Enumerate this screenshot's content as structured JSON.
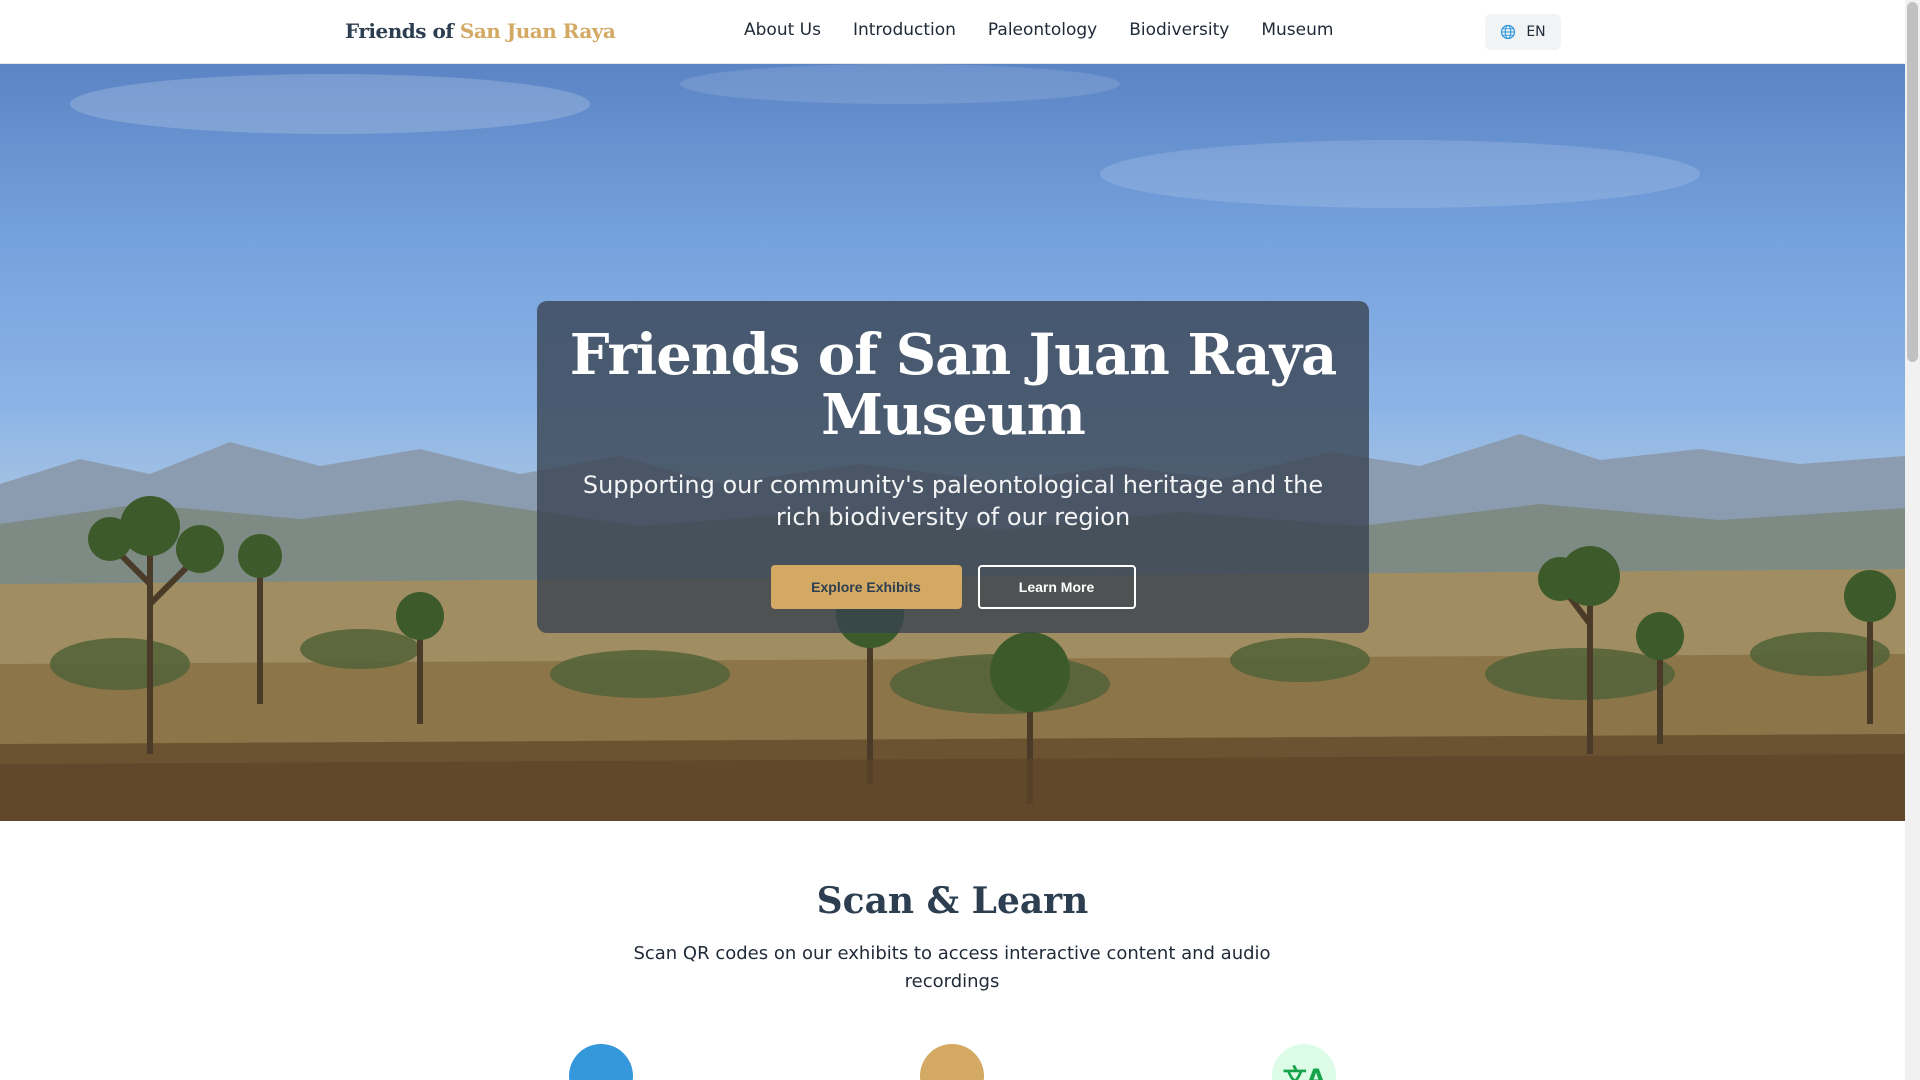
{
  "nav": {
    "logo_part1": "Friends of",
    "logo_part2": "San Juan Raya",
    "links": [
      "About Us",
      "Introduction",
      "Paleontology",
      "Biodiversity",
      "Museum"
    ],
    "language": "EN",
    "language_icon": "globe-icon"
  },
  "hero": {
    "title": "Friends of San Juan Raya Museum",
    "subtitle": "Supporting our community's paleontological heritage and the rich biodiversity of our region",
    "primary_button": "Explore Exhibits",
    "secondary_button": "Learn More",
    "background": "desert landscape with yucca plants and mountains"
  },
  "scan_section": {
    "title": "Scan & Learn",
    "subtitle": "Scan QR codes on our exhibits to access interactive content and audio recordings",
    "feature_icons": [
      "qr-code-icon",
      "audio-icon",
      "translate-icon"
    ],
    "translate_glyph": "文A"
  },
  "colors": {
    "brand_dark": "#2c3e50",
    "brand_gold": "#d4a964",
    "icon_blue": "#3498db",
    "icon_green_bg": "#dcfce7",
    "icon_green": "#16a34a"
  }
}
